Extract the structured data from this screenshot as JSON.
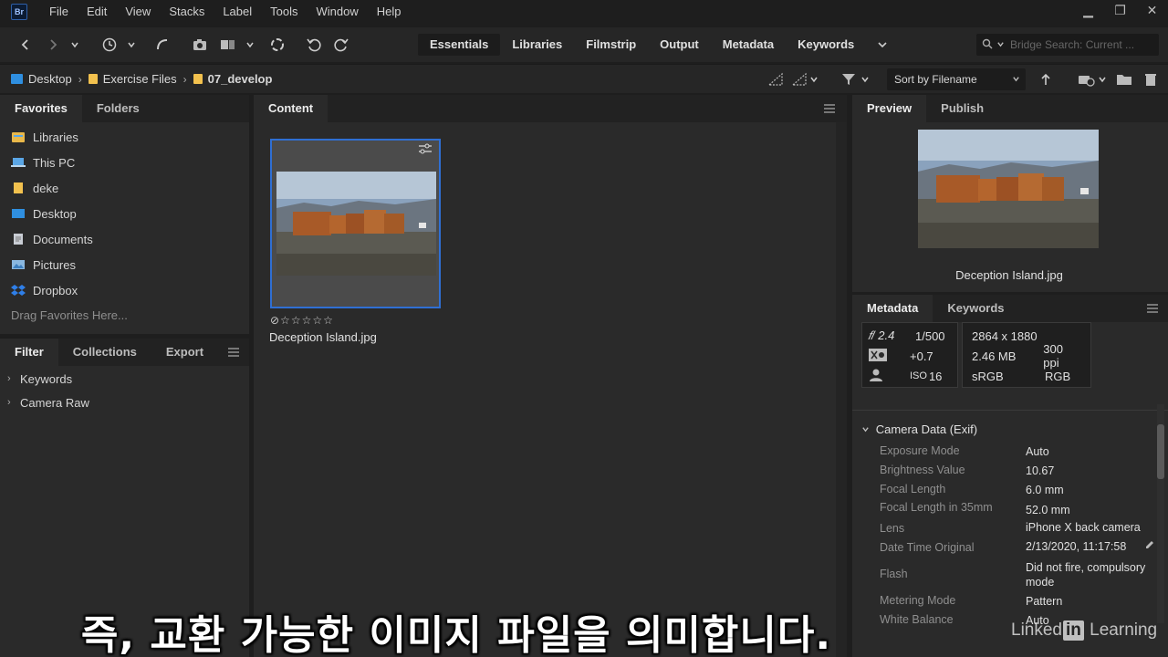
{
  "app": {
    "logo": "Br"
  },
  "menu": [
    "File",
    "Edit",
    "View",
    "Stacks",
    "Label",
    "Tools",
    "Window",
    "Help"
  ],
  "window_controls": {
    "minimize": "▁",
    "restore": "❐",
    "close": "✕"
  },
  "workspaces": [
    "Essentials",
    "Libraries",
    "Filmstrip",
    "Output",
    "Metadata",
    "Keywords"
  ],
  "search": {
    "placeholder": "Bridge Search: Current ..."
  },
  "breadcrumb": [
    "Desktop",
    "Exercise Files",
    "07_develop"
  ],
  "sort": {
    "label": "Sort by Filename"
  },
  "left_tabs": {
    "favorites": "Favorites",
    "folders": "Folders"
  },
  "favorites": [
    {
      "label": "Libraries",
      "icon": "libraries-icon",
      "color": "#e9b84a"
    },
    {
      "label": "This PC",
      "icon": "computer-icon",
      "color": "#5aa6e6"
    },
    {
      "label": "deke",
      "icon": "folder-icon",
      "color": "#f2c14e"
    },
    {
      "label": "Desktop",
      "icon": "desktop-icon",
      "color": "#2f8fe0"
    },
    {
      "label": "Documents",
      "icon": "documents-icon",
      "color": "#c9cdd4"
    },
    {
      "label": "Pictures",
      "icon": "pictures-icon",
      "color": "#8ab8e0"
    },
    {
      "label": "Dropbox",
      "icon": "dropbox-icon",
      "color": "#2f7fe8"
    }
  ],
  "drag_hint": "Drag Favorites Here...",
  "filter_tabs": {
    "filter": "Filter",
    "collections": "Collections",
    "export": "Export"
  },
  "filters": [
    "Keywords",
    "Camera Raw"
  ],
  "content": {
    "tab": "Content",
    "thumbnail": {
      "filename": "Deception Island.jpg",
      "rating": "⊘☆☆☆☆☆"
    }
  },
  "preview": {
    "tab": "Preview",
    "publish_tab": "Publish",
    "filename": "Deception Island.jpg"
  },
  "metadata": {
    "tab": "Metadata",
    "keywords_tab": "Keywords",
    "summary": {
      "aperture": "𝑓/ 2.4",
      "shutter": "1/500",
      "exposure_comp": "+0.7",
      "iso_label": "ISO",
      "iso": "16",
      "dimensions": "2864 x 1880",
      "file_size": "2.46 MB",
      "resolution": "300 ppi",
      "color_profile": "sRGB",
      "color_mode": "RGB"
    },
    "section_title": "Camera Data (Exif)",
    "fields": [
      {
        "key": "Exposure Mode",
        "value": "Auto"
      },
      {
        "key": "Brightness Value",
        "value": "10.67"
      },
      {
        "key": "Focal Length",
        "value": "6.0 mm"
      },
      {
        "key": "Focal Length in 35mm",
        "value": "52.0 mm"
      },
      {
        "key": "Lens",
        "value": "iPhone X back camera"
      },
      {
        "key": "Date Time Original",
        "value": "2/13/2020, 11:17:58"
      },
      {
        "key": "Flash",
        "value": "Did not fire, compulsory mode"
      },
      {
        "key": "Metering Mode",
        "value": "Pattern"
      },
      {
        "key": "White Balance",
        "value": "Auto"
      }
    ]
  },
  "subtitle": "즉, 교환 가능한 이미지 파일을 의미합니다.",
  "watermark": {
    "pre": "Linked",
    "in": "in",
    "post": " Learning"
  }
}
